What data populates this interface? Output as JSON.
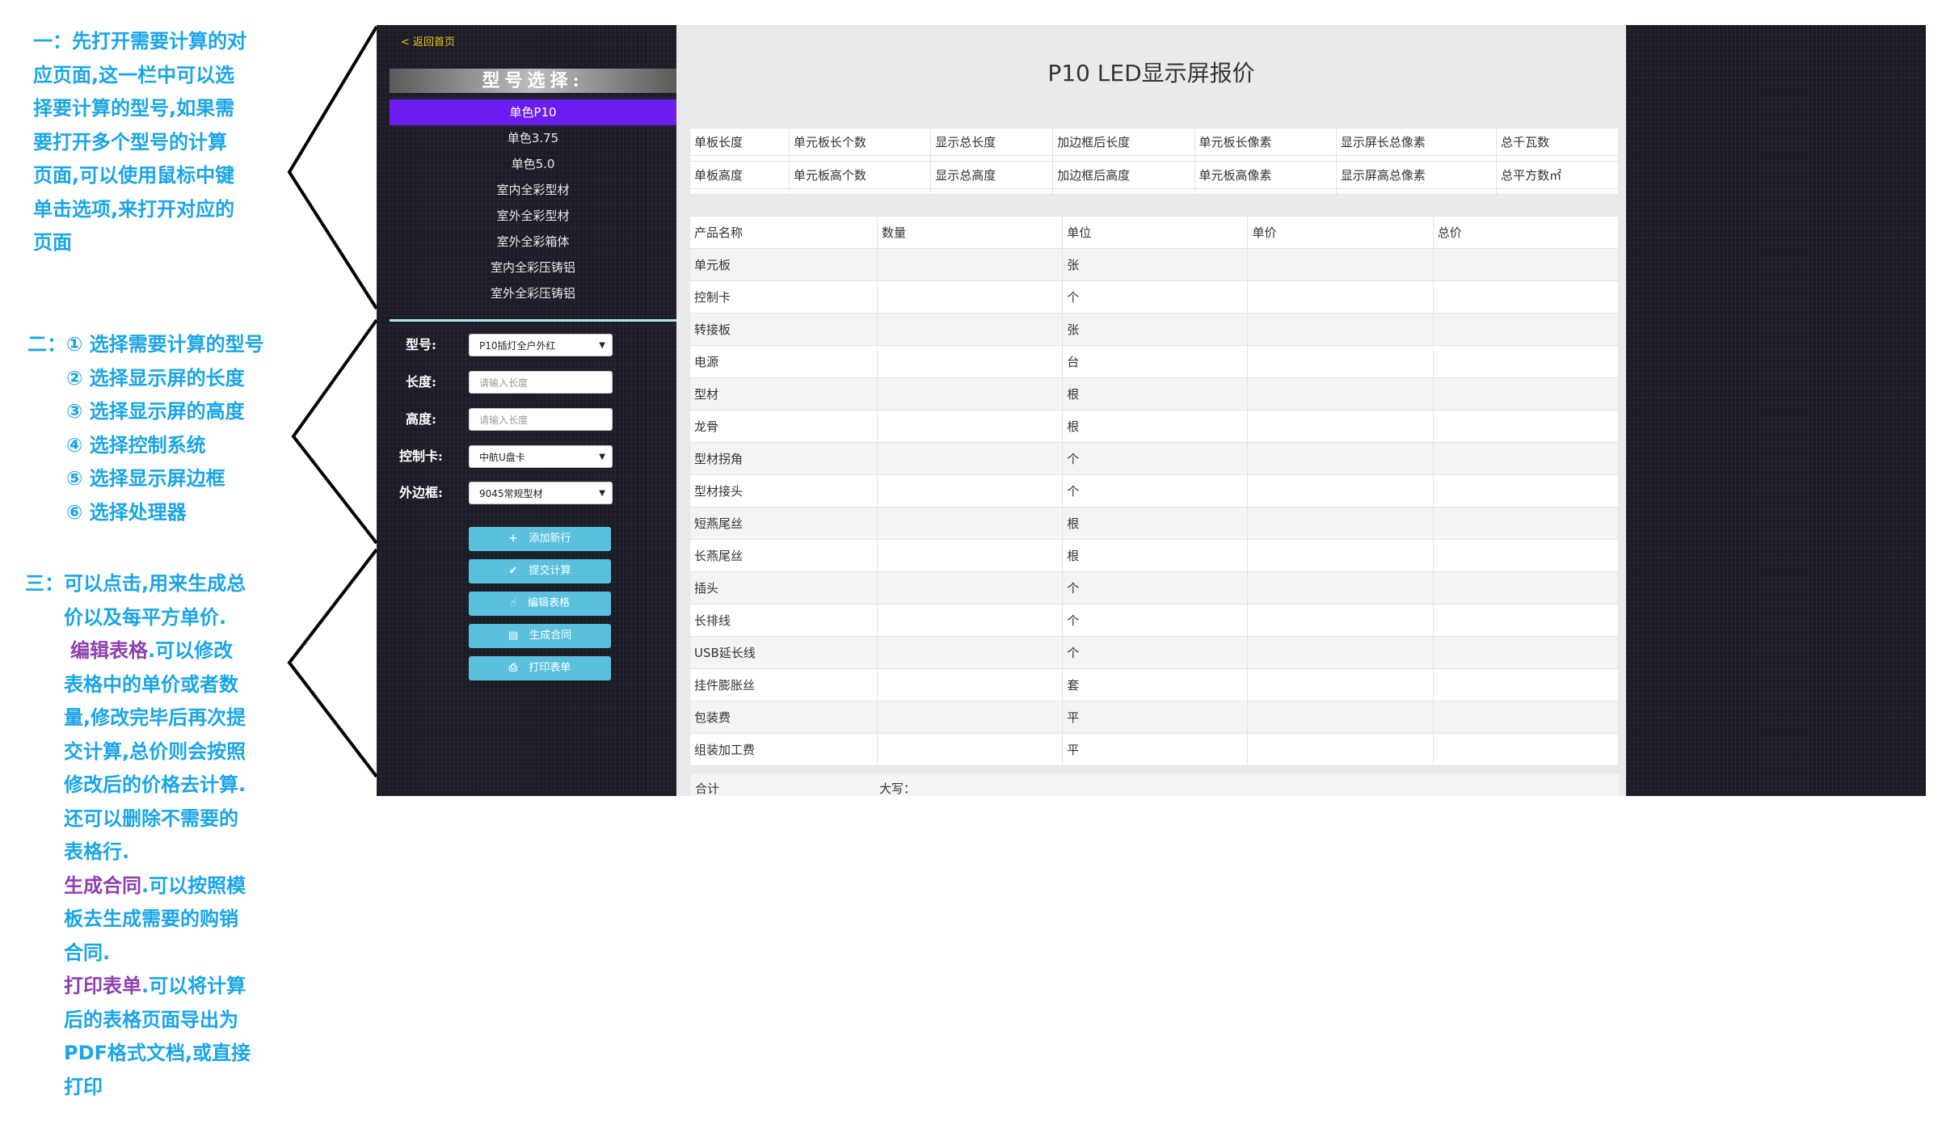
{
  "annotations": {
    "one": [
      "一：先打开需要计算的对",
      "应页面,这一栏中可以选",
      "择要计算的型号,如果需",
      "要打开多个型号的计算",
      "页面,可以使用鼠标中键",
      "单击选项,来打开对应的",
      "页面"
    ],
    "two": [
      "二：① 选择需要计算的型号",
      "② 选择显示屏的长度",
      "③ 选择显示屏的高度",
      "④ 选择控制系统",
      "⑤ 选择显示屏边框",
      "⑥ 选择处理器"
    ],
    "three_intro": [
      "三：可以点击,用来生成总",
      "价以及每平方单价."
    ],
    "three_edit_title": "编辑表格",
    "three_edit_text": [
      ".可以修改",
      "表格中的单价或者数",
      "量,修改完毕后再次提",
      "交计算,总价则会按照",
      "修改后的价格去计算.",
      "还可以删除不需要的",
      "表格行."
    ],
    "three_contract_title": "生成合同",
    "three_contract_text": [
      ".可以按照模",
      "板去生成需要的购销",
      "合同."
    ],
    "three_print_title": "打印表单",
    "three_print_text": [
      ".可以将计算",
      "后的表格页面导出为",
      "PDF格式文档,或直接",
      "打印"
    ]
  },
  "sidebar": {
    "back_link": "< 返回首页",
    "header": "型号选择:",
    "menu": [
      "单色P10",
      "单色3.75",
      "单色5.0",
      "室内全彩型材",
      "室外全彩型材",
      "室外全彩箱体",
      "室内全彩压铸铝",
      "室外全彩压铸铝"
    ],
    "active_menu_item": "单色P10",
    "form": {
      "model_label": "型号:",
      "model_value": "P10插灯全户外红",
      "length_label": "长度:",
      "length_placeholder": "请输入长度",
      "height_label": "高度:",
      "height_placeholder": "请输入长度",
      "control_label": "控制卡:",
      "control_value": "中航U盘卡",
      "frame_label": "外边框:",
      "frame_value": "9045常规型材"
    },
    "buttons": {
      "add_row": "添加新行",
      "submit": "提交计算",
      "edit": "编辑表格",
      "contract": "生成合同",
      "print": "打印表单"
    }
  },
  "main": {
    "title": "P10 LED显示屏报价",
    "spec_row1": [
      "单板长度",
      "单元板长个数",
      "显示总长度",
      "加边框后长度",
      "单元板长像素",
      "显示屏长总像素",
      "总千瓦数"
    ],
    "spec_row2": [
      "单板高度",
      "单元板高个数",
      "显示总高度",
      "加边框后高度",
      "单元板高像素",
      "显示屏高总像素",
      "总平方数㎡"
    ],
    "table_headers": [
      "产品名称",
      "数量",
      "单位",
      "单价",
      "总价"
    ],
    "rows": [
      {
        "name": "单元板",
        "unit": "张"
      },
      {
        "name": "控制卡",
        "unit": "个"
      },
      {
        "name": "转接板",
        "unit": "张"
      },
      {
        "name": "电源",
        "unit": "台"
      },
      {
        "name": "型材",
        "unit": "根"
      },
      {
        "name": "龙骨",
        "unit": "根"
      },
      {
        "name": "型材拐角",
        "unit": "个"
      },
      {
        "name": "型材接头",
        "unit": "个"
      },
      {
        "name": "短燕尾丝",
        "unit": "根"
      },
      {
        "name": "长燕尾丝",
        "unit": "根"
      },
      {
        "name": "插头",
        "unit": "个"
      },
      {
        "name": "长排线",
        "unit": "个"
      },
      {
        "name": "USB延长线",
        "unit": "个"
      },
      {
        "name": "挂件膨胀丝",
        "unit": "套"
      },
      {
        "name": "包装费",
        "unit": "平"
      },
      {
        "name": "组装加工费",
        "unit": "平"
      }
    ],
    "total_label": "合计",
    "capital_label": "大写："
  },
  "colors": {
    "annotation": "#1aa5e8",
    "highlight": "#8e3fb0",
    "active_menu": "#6b1cf0",
    "button": "#5bc0de",
    "back_link": "#f0c419"
  }
}
